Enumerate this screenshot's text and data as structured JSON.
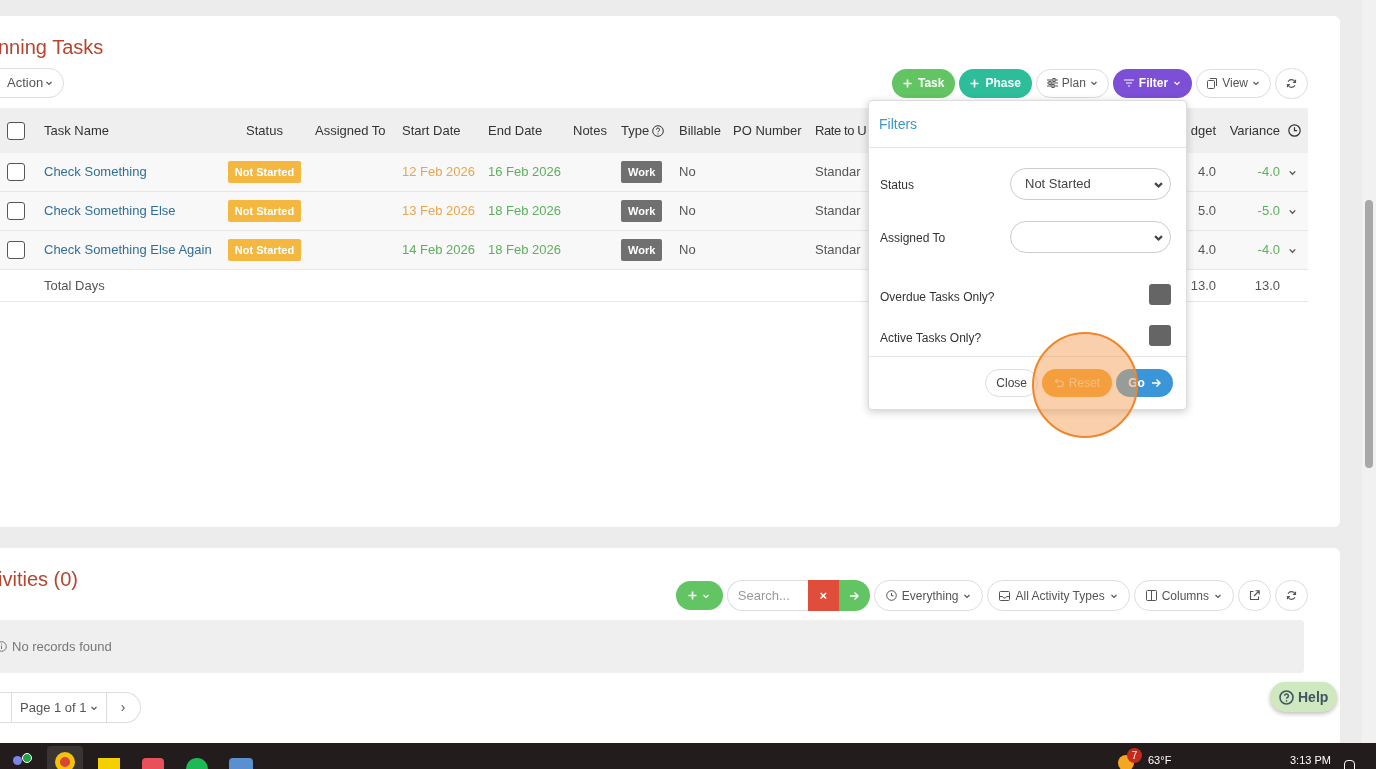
{
  "tasks_panel": {
    "title": "nning Tasks",
    "action_button": "Action",
    "toolbar": [
      {
        "kind": "add-green",
        "label": "Task"
      },
      {
        "kind": "add-teal",
        "label": "Phase"
      },
      {
        "kind": "plan",
        "label": "Plan"
      },
      {
        "kind": "filter",
        "label": "Filter",
        "expanded": true
      },
      {
        "kind": "view",
        "label": "View"
      },
      {
        "kind": "refresh"
      }
    ],
    "table": {
      "select_all_checked": false,
      "columns": [
        "Task Name",
        "Status",
        "Assigned To",
        "Start Date",
        "End Date",
        "Notes",
        "Type",
        "Billable",
        "PO Number",
        "Rate to U",
        "dget",
        "Variance"
      ],
      "rows": [
        {
          "checked": false,
          "name": "Check Something",
          "status": "Not Started",
          "start_date": {
            "text": "12 Feb 2026",
            "color": "#e8a64e"
          },
          "end_date": "16 Feb 2026",
          "type": "Work",
          "billable": "No",
          "rate": "Standar",
          "budget": "4.0",
          "variance": "-4.0",
          "expanded": false
        },
        {
          "checked": false,
          "name": "Check Something Else",
          "status": "Not Started",
          "start_date": {
            "text": "13 Feb 2026",
            "color": "#e8a64e"
          },
          "end_date": "18 Feb 2026",
          "type": "Work",
          "billable": "No",
          "rate": "Standar",
          "budget": "5.0",
          "variance": "-5.0",
          "expanded": false
        },
        {
          "checked": false,
          "name": "Check Something Else Again",
          "status": "Not Started",
          "start_date": {
            "text": "14 Feb 2026",
            "color": "#5cb05c"
          },
          "end_date": "18 Feb 2026",
          "type": "Work",
          "billable": "No",
          "rate": "Standar",
          "budget": "4.0",
          "variance": "-4.0",
          "expanded": false
        }
      ],
      "total": {
        "label": "Total Days",
        "budget": "13.0",
        "variance": "13.0"
      }
    }
  },
  "filter_popover": {
    "title": "Filters",
    "fields": [
      {
        "kind": "select",
        "label": "Status",
        "value": "Not Started"
      },
      {
        "kind": "select",
        "label": "Assigned To"
      },
      {
        "kind": "checkbox",
        "label": "Overdue Tasks Only?",
        "checked": false
      },
      {
        "kind": "checkbox",
        "label": "Active Tasks Only?",
        "checked": false
      }
    ],
    "buttons": [
      {
        "kind": "close",
        "label": "Close"
      },
      {
        "kind": "reset",
        "label": "Reset"
      },
      {
        "kind": "go",
        "label": "Go"
      }
    ]
  },
  "activities_panel": {
    "title": "ivities (0)",
    "search": {
      "placeholder": "Search..."
    },
    "clear_button": "×",
    "dropdowns": [
      {
        "kind": "time",
        "label": "Everything"
      },
      {
        "kind": "type",
        "label": "All Activity Types"
      },
      {
        "kind": "columns",
        "label": "Columns"
      }
    ],
    "empty_message": "No records found",
    "pagination": {
      "page_label": "Page 1 of 1",
      "next": "›"
    }
  },
  "help_button": "Help",
  "taskbar": {
    "weather_badge": "7",
    "temperature": "63°F",
    "time": "3:13 PM"
  }
}
